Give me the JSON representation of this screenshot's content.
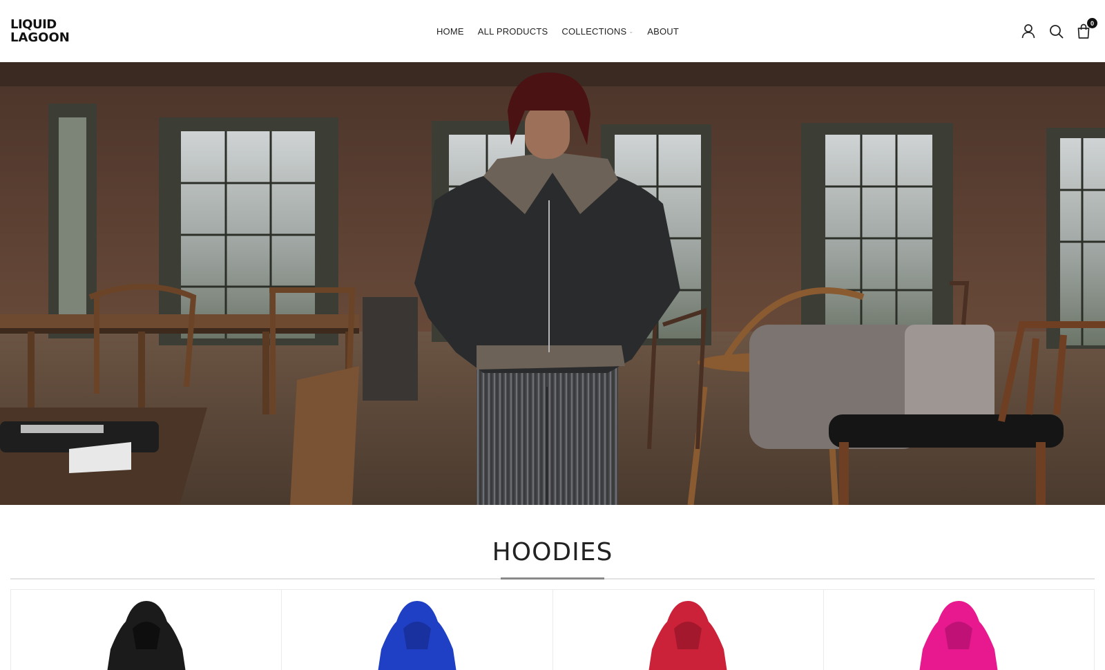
{
  "brand": {
    "logo_line1": "LIQUID",
    "logo_line2": "LAGOON"
  },
  "nav": {
    "items": [
      {
        "label": "HOME"
      },
      {
        "label": "ALL PRODUCTS"
      },
      {
        "label": "COLLECTIONS"
      },
      {
        "label": "ABOUT"
      }
    ]
  },
  "header_icons": {
    "account": "user-icon",
    "search": "search-icon",
    "cart": "shopping-bag-icon",
    "cart_count": "0"
  },
  "hero": {
    "image": "model in leather jacket and pinstripe pants in antique furniture warehouse"
  },
  "section": {
    "title": "HOODIES"
  },
  "products": [
    {
      "color": "#1a1a1a"
    },
    {
      "color": "#1f3fbf"
    },
    {
      "color": "#c8203a"
    },
    {
      "color": "#e6188e"
    }
  ]
}
